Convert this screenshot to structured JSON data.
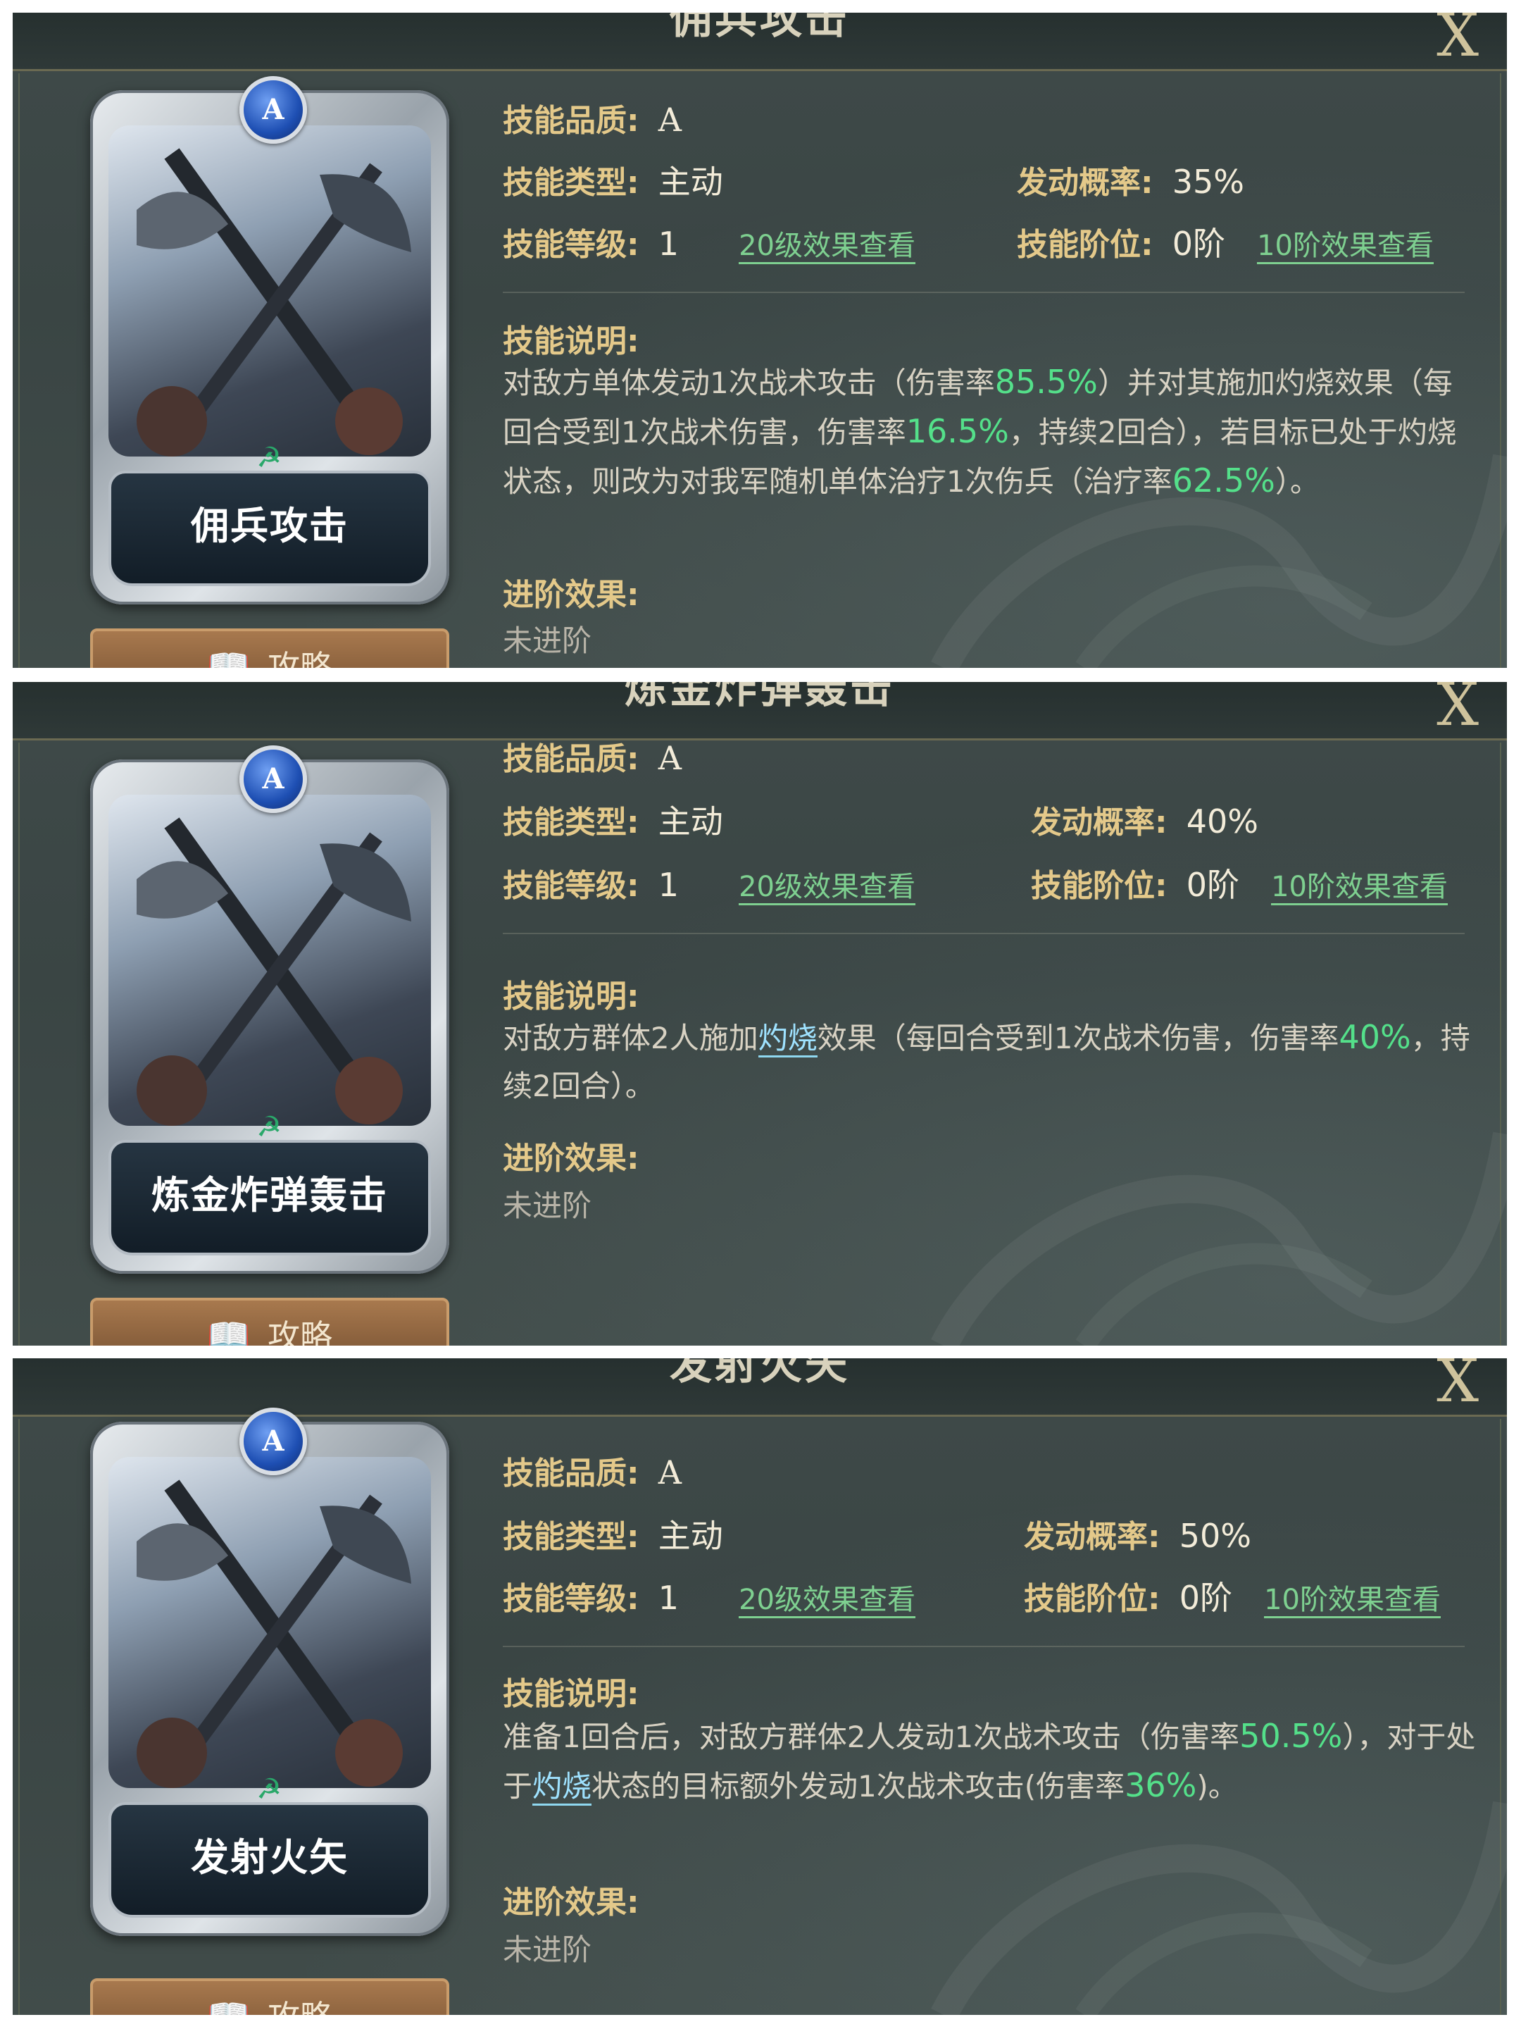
{
  "labels": {
    "quality": "技能品质:",
    "type": "技能类型:",
    "level": "技能等级:",
    "rate": "发动概率:",
    "tier": "技能阶位:",
    "description": "技能说明:",
    "advance": "进阶效果:"
  },
  "close_label": "X",
  "guide_label": "攻略",
  "panels": [
    {
      "title": "佣兵攻击",
      "card_name": "佣兵攻击",
      "quality": "A",
      "type": "主动",
      "level": "1",
      "level_link": "20级效果查看",
      "rate": "35%",
      "tier": "0阶",
      "tier_link": "10阶效果查看",
      "description": [
        {
          "t": "对敌方单体发动1次战术攻击（伤害率"
        },
        {
          "t": "85.5%",
          "s": "hl"
        },
        {
          "t": "）并对其施加灼烧效果（每回合受到1次战术伤害，伤害率"
        },
        {
          "t": "16.5%",
          "s": "hl"
        },
        {
          "t": "，持续2回合），若目标已处于灼烧状态，则改为对我军随机单体治疗1次伤兵（治疗率"
        },
        {
          "t": "62.5%",
          "s": "hl"
        },
        {
          "t": "）。"
        }
      ],
      "advance": "未进阶"
    },
    {
      "title": "炼金炸弹轰击",
      "card_name": "炼金炸弹轰击",
      "quality": "A",
      "type": "主动",
      "level": "1",
      "level_link": "20级效果查看",
      "rate": "40%",
      "tier": "0阶",
      "tier_link": "10阶效果查看",
      "description": [
        {
          "t": "对敌方群体2人施加"
        },
        {
          "t": "灼烧",
          "s": "kw"
        },
        {
          "t": "效果（每回合受到1次战术伤害，伤害率"
        },
        {
          "t": "40%",
          "s": "hl"
        },
        {
          "t": "，持续2回合）。"
        }
      ],
      "advance": "未进阶"
    },
    {
      "title": "发射火矢",
      "card_name": "发射火矢",
      "quality": "A",
      "type": "主动",
      "level": "1",
      "level_link": "20级效果查看",
      "rate": "50%",
      "tier": "0阶",
      "tier_link": "10阶效果查看",
      "description": [
        {
          "t": "准备1回合后，对敌方群体2人发动1次战术攻击（伤害率"
        },
        {
          "t": "50.5%",
          "s": "hl"
        },
        {
          "t": "），对于处于"
        },
        {
          "t": "灼烧",
          "s": "kw"
        },
        {
          "t": "状态的目标额外发动1次战术攻击(伤害率"
        },
        {
          "t": "36%",
          "s": "hl"
        },
        {
          "t": ")。"
        }
      ],
      "advance": "未进阶"
    }
  ]
}
